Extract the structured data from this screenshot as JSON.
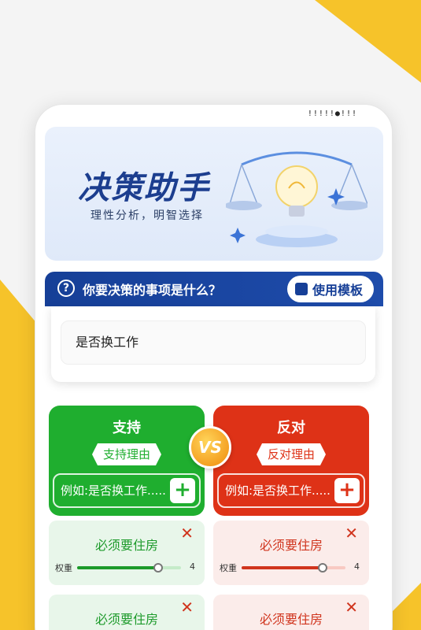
{
  "status_bar": {
    "text": "!!!!!●!!!"
  },
  "banner": {
    "title": "决策助手",
    "subtitle": "理性分析，明智选择"
  },
  "question": {
    "icon": "question-circle-icon",
    "label": "你要决策的事项是什么？",
    "template_button": "使用模板",
    "template_icon": "puzzle-icon",
    "answer": "是否换工作"
  },
  "pro": {
    "title": "支持",
    "tag": "支持理由",
    "input_placeholder": "例如:是否换工作.....",
    "add_icon": "plus-icon",
    "color": "#1fae2f"
  },
  "con": {
    "title": "反对",
    "tag": "反对理由",
    "input_placeholder": "例如:是否换工作.....",
    "add_icon": "plus-icon",
    "color": "#de3217"
  },
  "vs_label": "VS",
  "reasons": {
    "pro": [
      {
        "text": "必须要住房",
        "weight_label": "权重",
        "weight": 4,
        "weight_fraction": 0.78
      },
      {
        "text": "必须要住房"
      }
    ],
    "con": [
      {
        "text": "必须要住房",
        "weight_label": "权重",
        "weight": 4,
        "weight_fraction": 0.78
      },
      {
        "text": "必须要住房"
      }
    ]
  },
  "colors": {
    "accent_blue": "#163f97",
    "yellow": "#f6c32a"
  }
}
